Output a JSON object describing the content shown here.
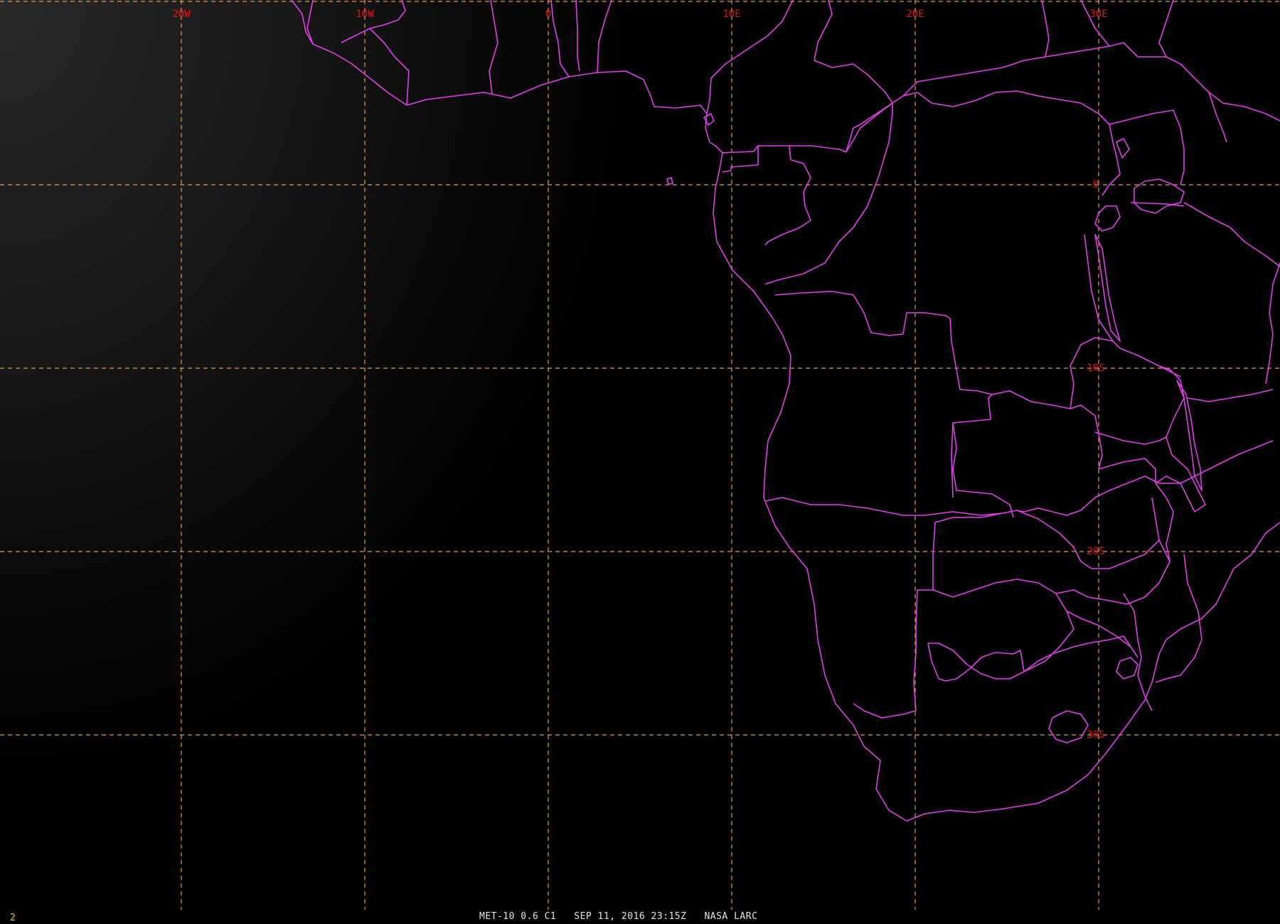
{
  "map": {
    "grid_labels": {
      "longitude": [
        {
          "text": "20W",
          "lon": -20
        },
        {
          "text": "10W",
          "lon": -10
        },
        {
          "text": "0",
          "lon": 0
        },
        {
          "text": "10E",
          "lon": 10
        },
        {
          "text": "20E",
          "lon": 20
        },
        {
          "text": "30E",
          "lon": 30
        }
      ],
      "latitude": [
        {
          "text": "0",
          "lat": 0
        },
        {
          "text": "10S",
          "lat": -10
        },
        {
          "text": "20S",
          "lat": -20
        },
        {
          "text": "30S",
          "lat": -30
        }
      ]
    },
    "grid_color": "#e0a050",
    "border_color": "#e040e8",
    "label_color": "#d81818",
    "region": "Western and Southern Africa"
  },
  "status_bar": {
    "frame_number": "2",
    "satellite": "MET-10",
    "band": "0.6",
    "channel": "C1",
    "date": "SEP 11, 2016",
    "time": "23:15Z",
    "source": "NASA LARC",
    "frame_color": "#e8d020"
  }
}
